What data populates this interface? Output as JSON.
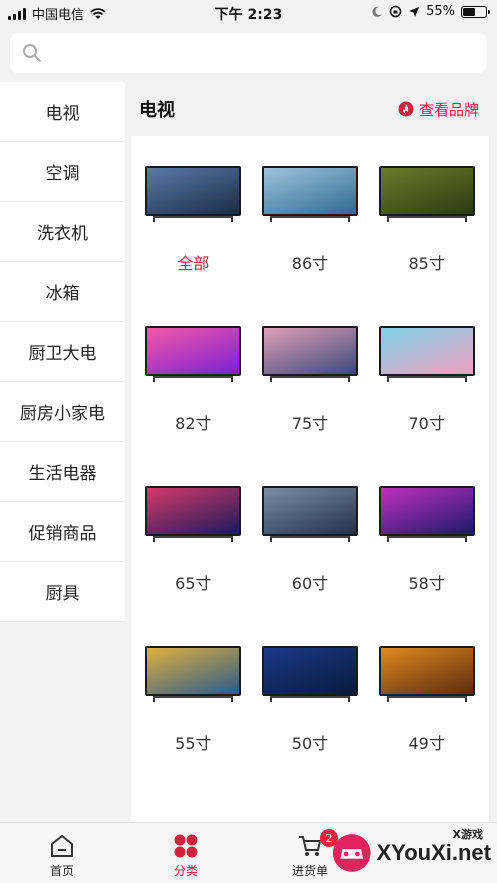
{
  "status_bar": {
    "carrier": "中国电信",
    "time": "下午 2:23",
    "battery": "55%",
    "battery_level": 0.55
  },
  "search": {
    "placeholder": ""
  },
  "sidebar": {
    "items": [
      {
        "label": "电视",
        "active": true
      },
      {
        "label": "空调"
      },
      {
        "label": "洗衣机"
      },
      {
        "label": "冰箱"
      },
      {
        "label": "厨卫大电"
      },
      {
        "label": "厨房小家电"
      },
      {
        "label": "生活电器"
      },
      {
        "label": "促销商品"
      },
      {
        "label": "厨具"
      }
    ]
  },
  "main": {
    "title": "电视",
    "brand_link": "查看品牌",
    "products": [
      {
        "label": "全部",
        "selected": true,
        "colors": [
          "#5a7aa8",
          "#1c2b45"
        ]
      },
      {
        "label": "86寸",
        "colors": [
          "#9fc4de",
          "#2e6a8f"
        ]
      },
      {
        "label": "85寸",
        "colors": [
          "#6a7d2a",
          "#2b3a14"
        ]
      },
      {
        "label": "82寸",
        "colors": [
          "#f25aa8",
          "#7b1fd6"
        ]
      },
      {
        "label": "75寸",
        "colors": [
          "#e0a0b8",
          "#3a4a7a"
        ]
      },
      {
        "label": "70寸",
        "colors": [
          "#7fd3e8",
          "#f0a0c0"
        ]
      },
      {
        "label": "65寸",
        "colors": [
          "#d43a6a",
          "#1a1a5a"
        ]
      },
      {
        "label": "60寸",
        "colors": [
          "#7a8ea8",
          "#22304a"
        ]
      },
      {
        "label": "58寸",
        "colors": [
          "#c030c0",
          "#1a1a6a"
        ]
      },
      {
        "label": "55寸",
        "colors": [
          "#e0b040",
          "#2a5a8a"
        ]
      },
      {
        "label": "50寸",
        "colors": [
          "#1a3a8a",
          "#0a1a3a"
        ]
      },
      {
        "label": "49寸",
        "colors": [
          "#e08a20",
          "#5a2a10"
        ]
      }
    ]
  },
  "tabbar": {
    "items": [
      {
        "label": "首页",
        "icon": "home-icon"
      },
      {
        "label": "分类",
        "icon": "category-icon",
        "active": true
      },
      {
        "label": "进货单",
        "icon": "cart-icon",
        "badge": "2"
      }
    ]
  },
  "watermark": {
    "text": "XYouXi.net",
    "small_text": "X游戏"
  },
  "colors": {
    "accent": "#d0233f",
    "background": "#f2f2f2"
  }
}
